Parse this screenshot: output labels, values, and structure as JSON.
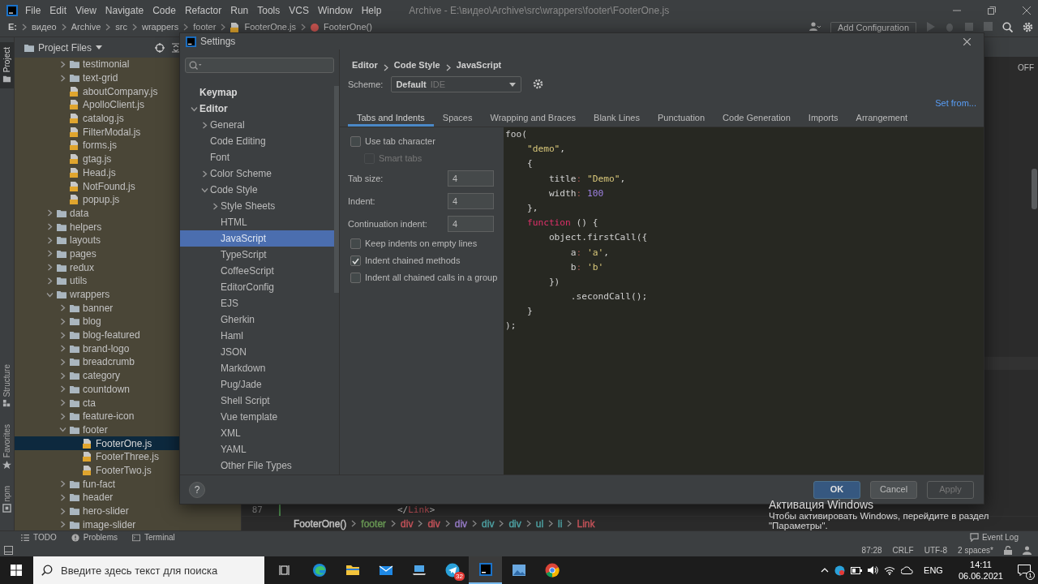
{
  "menu_bar": {
    "items": [
      "File",
      "Edit",
      "View",
      "Navigate",
      "Code",
      "Refactor",
      "Run",
      "Tools",
      "VCS",
      "Window",
      "Help"
    ],
    "title": "Archive - E:\\видео\\Archive\\src\\wrappers\\footer\\FooterOne.js"
  },
  "navigation_bar": {
    "crumbs": [
      {
        "label": "E:",
        "kind": "drive"
      },
      {
        "label": "видео",
        "kind": "folder"
      },
      {
        "label": "Archive",
        "kind": "folder"
      },
      {
        "label": "src",
        "kind": "folder"
      },
      {
        "label": "wrappers",
        "kind": "folder"
      },
      {
        "label": "footer",
        "kind": "folder"
      },
      {
        "label": "FooterOne.js",
        "kind": "file"
      },
      {
        "label": "FooterOne()",
        "kind": "function"
      }
    ],
    "run_configuration": "Add Configuration"
  },
  "tool_strip": {
    "top": [
      {
        "label": "Project",
        "selected": true
      }
    ],
    "bottom": [
      {
        "label": "Structure",
        "selected": false
      },
      {
        "label": "Favorites",
        "selected": false
      },
      {
        "label": "npm",
        "selected": false
      }
    ]
  },
  "project_panel": {
    "title": "Project Files",
    "continued_items": [
      {
        "label": "testimonial",
        "kind": "folder",
        "expanded": false,
        "selected": false
      },
      {
        "label": "text-grid",
        "kind": "folder",
        "expanded": false,
        "selected": false
      },
      {
        "label": "aboutCompany.js",
        "kind": "js",
        "selected": false
      },
      {
        "label": "ApolloClient.js",
        "kind": "js",
        "selected": false
      },
      {
        "label": "catalog.js",
        "kind": "js",
        "selected": false
      },
      {
        "label": "FilterModal.js",
        "kind": "js",
        "selected": false
      },
      {
        "label": "forms.js",
        "kind": "js",
        "selected": false
      },
      {
        "label": "gtag.js",
        "kind": "js",
        "selected": false
      },
      {
        "label": "Head.js",
        "kind": "js",
        "selected": false
      },
      {
        "label": "NotFound.js",
        "kind": "js",
        "selected": false
      },
      {
        "label": "popup.js",
        "kind": "js",
        "selected": false
      }
    ],
    "items": [
      {
        "label": "data",
        "kind": "folder",
        "expanded": false,
        "selected": false
      },
      {
        "label": "helpers",
        "kind": "folder",
        "expanded": false,
        "selected": false
      },
      {
        "label": "layouts",
        "kind": "folder",
        "expanded": false,
        "selected": false
      },
      {
        "label": "pages",
        "kind": "folder",
        "expanded": false,
        "selected": false
      },
      {
        "label": "redux",
        "kind": "folder",
        "expanded": false,
        "selected": false
      },
      {
        "label": "utils",
        "kind": "folder",
        "expanded": false,
        "selected": false
      },
      {
        "label": "wrappers",
        "kind": "folder",
        "expanded": true,
        "selected": false,
        "children": [
          {
            "label": "banner",
            "kind": "folder",
            "expanded": false,
            "selected": false
          },
          {
            "label": "blog",
            "kind": "folder",
            "expanded": false,
            "selected": false
          },
          {
            "label": "blog-featured",
            "kind": "folder",
            "expanded": false,
            "selected": false
          },
          {
            "label": "brand-logo",
            "kind": "folder",
            "expanded": false,
            "selected": false
          },
          {
            "label": "breadcrumb",
            "kind": "folder",
            "expanded": false,
            "selected": false
          },
          {
            "label": "category",
            "kind": "folder",
            "expanded": false,
            "selected": false
          },
          {
            "label": "countdown",
            "kind": "folder",
            "expanded": false,
            "selected": false
          },
          {
            "label": "cta",
            "kind": "folder",
            "expanded": false,
            "selected": false
          },
          {
            "label": "feature-icon",
            "kind": "folder",
            "expanded": false,
            "selected": false
          },
          {
            "label": "footer",
            "kind": "folder",
            "expanded": true,
            "selected": false,
            "children": [
              {
                "label": "FooterOne.js",
                "kind": "js",
                "selected": true
              },
              {
                "label": "FooterThree.js",
                "kind": "js",
                "selected": false
              },
              {
                "label": "FooterTwo.js",
                "kind": "js",
                "selected": false
              }
            ]
          },
          {
            "label": "fun-fact",
            "kind": "folder",
            "expanded": false,
            "selected": false
          },
          {
            "label": "header",
            "kind": "folder",
            "expanded": false,
            "selected": false
          },
          {
            "label": "hero-slider",
            "kind": "folder",
            "expanded": false,
            "selected": false
          },
          {
            "label": "image-slider",
            "kind": "folder",
            "expanded": false,
            "selected": false
          }
        ]
      }
    ]
  },
  "editor": {
    "toggle": "OFF",
    "line_number": "87",
    "code": [
      {
        "text": "</",
        "kind": "plain"
      },
      {
        "text": "Link",
        "kind": "tag"
      },
      {
        "text": ">",
        "kind": "plain"
      }
    ],
    "breadcrumbs": [
      {
        "label": "FooterOne()",
        "color": "#c6c6c6"
      },
      {
        "label": "footer",
        "color": "#6a9955"
      },
      {
        "label": "div",
        "color": "#c7545b"
      },
      {
        "label": "div",
        "color": "#c7545b"
      },
      {
        "label": "div",
        "color": "#9a7ecc"
      },
      {
        "label": "div",
        "color": "#4fa3a5"
      },
      {
        "label": "div",
        "color": "#4fa3a5"
      },
      {
        "label": "ul",
        "color": "#4fa3a5"
      },
      {
        "label": "li",
        "color": "#4fa3a5"
      },
      {
        "label": "Link",
        "color": "#c7545b"
      }
    ]
  },
  "settings_dialog": {
    "title": "Settings",
    "tree": [
      {
        "label": "Keymap",
        "selected": false
      },
      {
        "label": "Editor",
        "expanded": true,
        "selected": false,
        "children": [
          {
            "label": "General",
            "expanded": false,
            "selected": false
          },
          {
            "label": "Code Editing",
            "selected": false
          },
          {
            "label": "Font",
            "selected": false
          },
          {
            "label": "Color Scheme",
            "expanded": false,
            "selected": false
          },
          {
            "label": "Code Style",
            "expanded": true,
            "selected": false,
            "children": [
              {
                "label": "Style Sheets",
                "expanded": false,
                "selected": false
              },
              {
                "label": "HTML",
                "selected": false
              },
              {
                "label": "JavaScript",
                "selected": true
              },
              {
                "label": "TypeScript",
                "selected": false
              },
              {
                "label": "CoffeeScript",
                "selected": false
              },
              {
                "label": "EditorConfig",
                "selected": false
              },
              {
                "label": "EJS",
                "selected": false
              },
              {
                "label": "Gherkin",
                "selected": false
              },
              {
                "label": "Haml",
                "selected": false
              },
              {
                "label": "JSON",
                "selected": false
              },
              {
                "label": "Markdown",
                "selected": false
              },
              {
                "label": "Pug/Jade",
                "selected": false
              },
              {
                "label": "Shell Script",
                "selected": false
              },
              {
                "label": "Vue template",
                "selected": false
              },
              {
                "label": "XML",
                "selected": false
              },
              {
                "label": "YAML",
                "selected": false
              },
              {
                "label": "Other File Types",
                "selected": false
              }
            ]
          }
        ]
      }
    ],
    "breadcrumb": [
      "Editor",
      "Code Style",
      "JavaScript"
    ],
    "scheme": {
      "label": "Scheme:",
      "name": "Default",
      "scope": "IDE"
    },
    "set_from": "Set from...",
    "tabs": [
      {
        "label": "Tabs and Indents",
        "selected": true
      },
      {
        "label": "Spaces",
        "selected": false
      },
      {
        "label": "Wrapping and Braces",
        "selected": false
      },
      {
        "label": "Blank Lines",
        "selected": false
      },
      {
        "label": "Punctuation",
        "selected": false
      },
      {
        "label": "Code Generation",
        "selected": false
      },
      {
        "label": "Imports",
        "selected": false
      },
      {
        "label": "Arrangement",
        "selected": false
      }
    ],
    "options": [
      {
        "kind": "checkbox",
        "label": "Use tab character",
        "checked": false,
        "disabled": false,
        "children": [
          {
            "kind": "checkbox",
            "label": "Smart tabs",
            "checked": false,
            "disabled": true
          }
        ]
      },
      {
        "kind": "number",
        "label": "Tab size:",
        "value": "4"
      },
      {
        "kind": "number",
        "label": "Indent:",
        "value": "4"
      },
      {
        "kind": "number",
        "label": "Continuation indent:",
        "value": "4"
      },
      {
        "kind": "checkbox",
        "label": "Keep indents on empty lines",
        "checked": false,
        "disabled": false
      },
      {
        "kind": "checkbox",
        "label": "Indent chained methods",
        "checked": true,
        "disabled": false
      },
      {
        "kind": "checkbox",
        "label": "Indent all chained calls in a group",
        "checked": false,
        "disabled": false
      }
    ],
    "preview_lines": [
      [
        {
          "text": "foo(",
          "kind": "plain"
        }
      ],
      [
        {
          "text": "    \"demo\"",
          "kind": "string"
        },
        {
          "text": ",",
          "kind": "plain"
        }
      ],
      [
        {
          "text": "    {",
          "kind": "plain"
        }
      ],
      [
        {
          "text": "        title",
          "kind": "plain"
        },
        {
          "text": ":",
          "kind": "colon"
        },
        {
          "text": " \"Demo\"",
          "kind": "string"
        },
        {
          "text": ",",
          "kind": "plain"
        }
      ],
      [
        {
          "text": "        width",
          "kind": "plain"
        },
        {
          "text": ":",
          "kind": "colon"
        },
        {
          "text": " 100",
          "kind": "number"
        }
      ],
      [
        {
          "text": "    },",
          "kind": "plain"
        }
      ],
      [
        {
          "text": "    function",
          "kind": "keyword"
        },
        {
          "text": " () {",
          "kind": "plain"
        }
      ],
      [
        {
          "text": "        object.firstCall({",
          "kind": "plain"
        }
      ],
      [
        {
          "text": "            a",
          "kind": "plain"
        },
        {
          "text": ":",
          "kind": "colon"
        },
        {
          "text": " 'a'",
          "kind": "string"
        },
        {
          "text": ",",
          "kind": "plain"
        }
      ],
      [
        {
          "text": "            b",
          "kind": "plain"
        },
        {
          "text": ":",
          "kind": "colon"
        },
        {
          "text": " 'b'",
          "kind": "string"
        }
      ],
      [
        {
          "text": "        })",
          "kind": "plain"
        }
      ],
      [
        {
          "text": "            .secondCall();",
          "kind": "plain"
        }
      ],
      [
        {
          "text": "    }",
          "kind": "plain"
        }
      ],
      [
        {
          "text": ");",
          "kind": "plain"
        }
      ]
    ],
    "help": "?",
    "buttons": [
      {
        "label": "OK",
        "kind": "primary",
        "disabled": false
      },
      {
        "label": "Cancel",
        "kind": "normal",
        "disabled": false
      },
      {
        "label": "Apply",
        "kind": "normal",
        "disabled": true
      }
    ]
  },
  "tool_windows": [
    {
      "label": "TODO",
      "kind": "list"
    },
    {
      "label": "Problems",
      "kind": "problems"
    },
    {
      "label": "Terminal",
      "kind": "terminal"
    }
  ],
  "event_log": "Event Log",
  "status_bar": {
    "items": [
      "87:28",
      "CRLF",
      "UTF-8",
      "2 spaces*"
    ]
  },
  "activation_notice": {
    "title": "Активация Windows",
    "message": "Чтобы активировать Windows, перейдите в раздел \"Параметры\"."
  },
  "taskbar": {
    "search_placeholder": "Введите здесь текст для поиска",
    "apps": [
      {
        "kind": "task-view",
        "selected": false
      },
      {
        "kind": "edge",
        "selected": false
      },
      {
        "kind": "explorer",
        "selected": false
      },
      {
        "kind": "mail",
        "selected": false
      },
      {
        "kind": "device",
        "selected": false
      },
      {
        "kind": "telegram",
        "selected": false,
        "badge": "32"
      },
      {
        "kind": "webstorm",
        "selected": true
      },
      {
        "kind": "photos",
        "selected": false
      },
      {
        "kind": "chrome",
        "selected": false
      }
    ],
    "language": "ENG",
    "time": "14:11",
    "date": "06.06.2021",
    "notifications": "1"
  }
}
